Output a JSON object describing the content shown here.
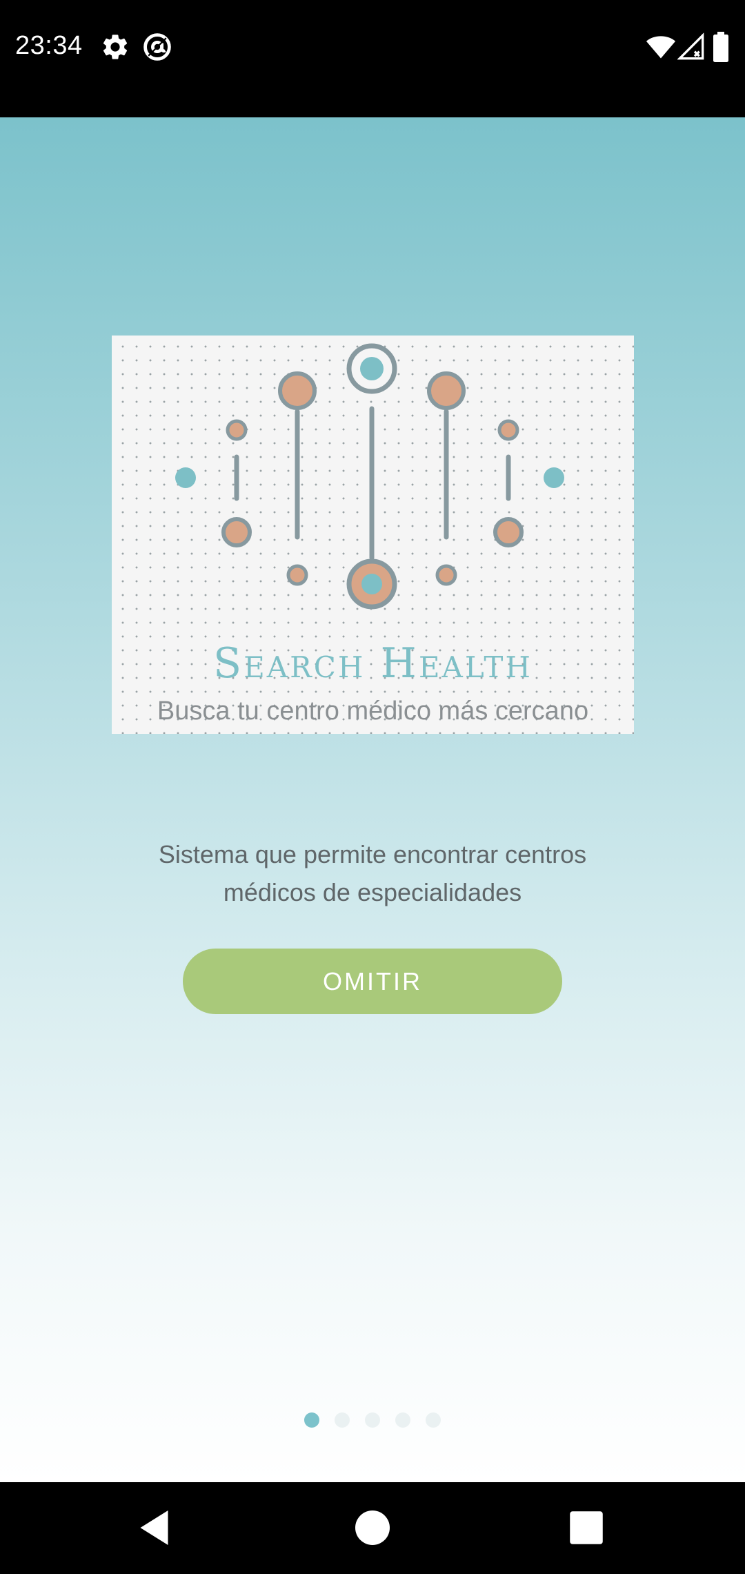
{
  "status_bar": {
    "time": "23:34",
    "icons": [
      "gear-icon",
      "at-sign-icon",
      "wifi-icon",
      "signal-icon",
      "battery-icon"
    ]
  },
  "logo": {
    "title": "Search Health",
    "subtitle": "Busca tu centro médico más cercano"
  },
  "main": {
    "description": "Sistema que permite encontrar centros médicos de especialidades",
    "skip_label": "OMITIR"
  },
  "pager": {
    "total": 5,
    "active_index": 0
  },
  "nav_bar": {
    "icons": [
      "back-icon",
      "home-icon",
      "recents-icon"
    ]
  },
  "colors": {
    "accent_teal": "#7cc2cb",
    "button_green": "#a9c97a",
    "logo_orange": "#d9a587",
    "logo_gray": "#87999f"
  }
}
